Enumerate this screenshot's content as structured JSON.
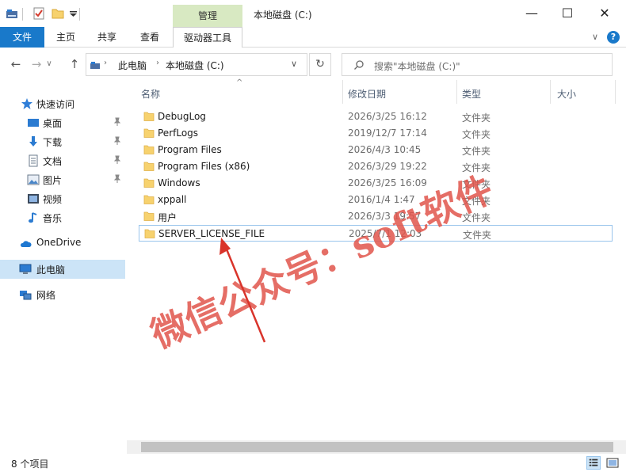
{
  "window": {
    "title": "本地磁盘 (C:)",
    "manage_tab": "管理",
    "minimize": "—",
    "maximize": "☐",
    "close": "✕"
  },
  "ribbon": {
    "tabs": [
      "文件",
      "主页",
      "共享",
      "查看",
      "驱动器工具"
    ],
    "collapse": "∨",
    "help": "?"
  },
  "address": {
    "path": [
      "此电脑",
      "本地磁盘 (C:)"
    ],
    "search_placeholder": "搜索\"本地磁盘 (C:)\"",
    "back": "←",
    "forward": "→",
    "up": "↑",
    "dropdown": "∨",
    "refresh": "↻"
  },
  "sidebar": {
    "quick_access": "快速访问",
    "items": [
      "桌面",
      "下载",
      "文档",
      "图片",
      "视频",
      "音乐"
    ],
    "onedrive": "OneDrive",
    "this_pc": "此电脑",
    "network": "网络"
  },
  "columns": {
    "name": "名称",
    "date": "修改日期",
    "type": "类型",
    "size": "大小",
    "sort_indicator": "^"
  },
  "files": [
    {
      "name": "DebugLog",
      "date": "2026/3/25 16:12",
      "type": "文件夹"
    },
    {
      "name": "PerfLogs",
      "date": "2019/12/7 17:14",
      "type": "文件夹"
    },
    {
      "name": "Program Files",
      "date": "2026/4/3 10:45",
      "type": "文件夹"
    },
    {
      "name": "Program Files (x86)",
      "date": "2026/3/29 19:22",
      "type": "文件夹"
    },
    {
      "name": "Windows",
      "date": "2026/3/25 16:09",
      "type": "文件夹"
    },
    {
      "name": "xppall",
      "date": "2016/1/4 1:47",
      "type": "文件夹"
    },
    {
      "name": "用户",
      "date": "2026/3/3 19:57",
      "type": "文件夹"
    },
    {
      "name": "SERVER_LICENSE_FILE",
      "date": "2025/7/1 12:03",
      "type": "文件夹"
    }
  ],
  "status": {
    "count": "8 个项目"
  },
  "watermark": "微信公众号：soft软件",
  "colors": {
    "accent": "#1979ca",
    "manage_tab": "#d8e9c2",
    "folder": "#f7d26e",
    "watermark": "#e0554b",
    "selection_border": "#99c5ec"
  }
}
